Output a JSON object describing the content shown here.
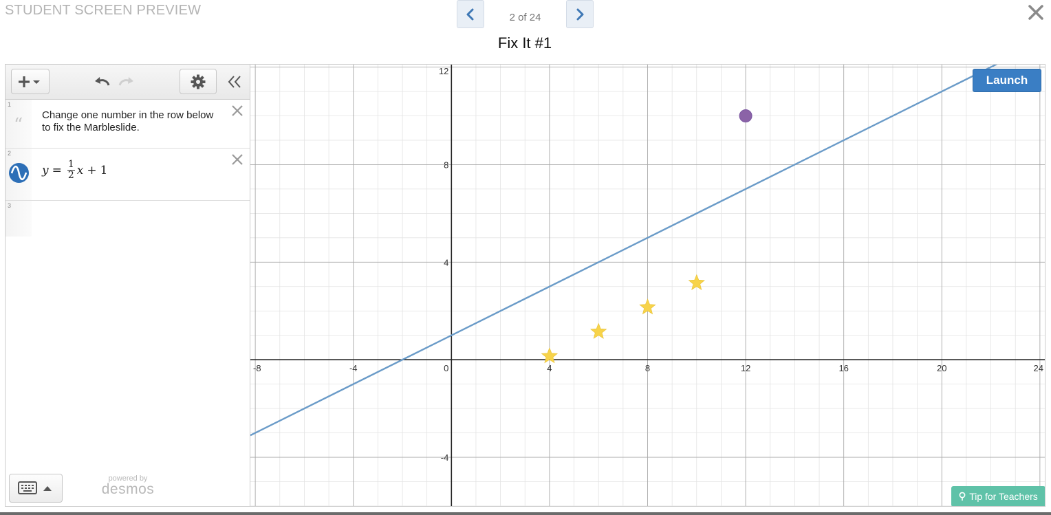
{
  "header": {
    "preview_title": "STUDENT SCREEN PREVIEW",
    "page_counter": "2 of 24",
    "screen_title": "Fix It #1"
  },
  "expressions": {
    "rows": [
      {
        "index": "1",
        "type": "note",
        "text": "Change one number in the row below to fix the Marbleslide."
      },
      {
        "index": "2",
        "type": "expression",
        "latex": "y = 1/2 x + 1",
        "lhs": "y",
        "eq": "=",
        "num": "1",
        "den": "2",
        "var": "x",
        "op": "+",
        "const": "1"
      },
      {
        "index": "3",
        "type": "empty"
      }
    ]
  },
  "footer": {
    "powered_by": "powered by",
    "brand": "desmos"
  },
  "buttons": {
    "launch": "Launch",
    "tip": "Tip for Teachers"
  },
  "colors": {
    "line": "#6a9bc8",
    "star": "#f7d34a",
    "marble": "#8b63a7",
    "launch": "#3a7ec4",
    "tip": "#5fc2a8"
  },
  "chart_data": {
    "type": "scatter",
    "x_ticks": [
      "-8",
      "-4",
      "0",
      "4",
      "8",
      "12",
      "16",
      "20",
      "24"
    ],
    "y_ticks": [
      "12",
      "8",
      "4",
      "-4"
    ],
    "xlim": [
      -8.2,
      24.2
    ],
    "ylim": [
      -6.0,
      12.1
    ],
    "grid": true,
    "series": [
      {
        "kind": "line",
        "slope": 0.5,
        "intercept": 1
      },
      {
        "kind": "stars",
        "points": [
          [
            4,
            0.15
          ],
          [
            6,
            1.15
          ],
          [
            8,
            2.15
          ],
          [
            10,
            3.15
          ]
        ]
      },
      {
        "kind": "marble",
        "points": [
          [
            12,
            10
          ]
        ]
      }
    ]
  }
}
